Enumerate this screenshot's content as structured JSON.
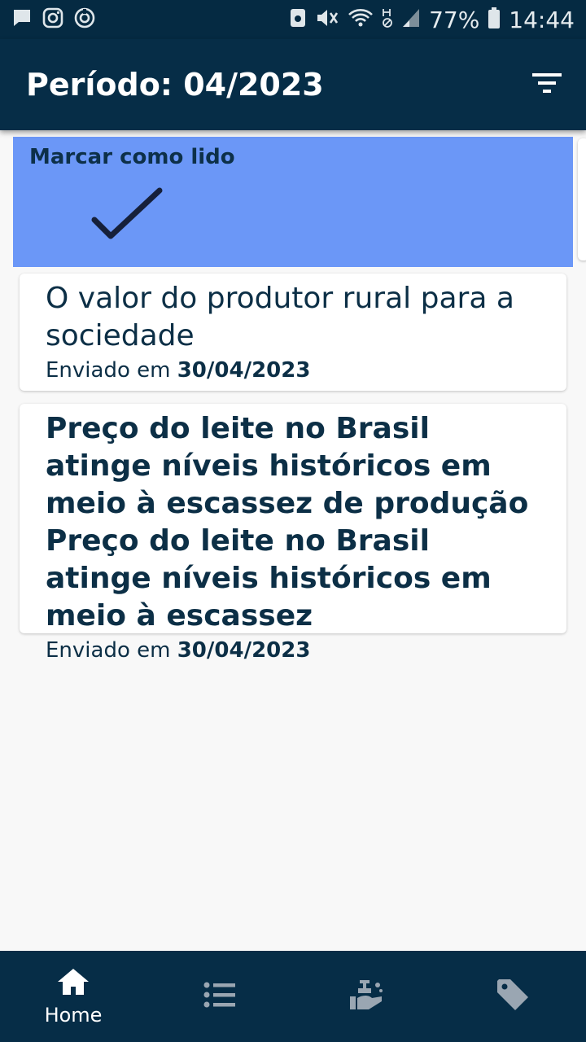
{
  "status_bar": {
    "battery": "77%",
    "time": "14:44",
    "left_icons": [
      "chat-icon",
      "instagram-icon",
      "sync-icon"
    ],
    "right_icons": [
      "save-icon",
      "mute-icon",
      "wifi-icon",
      "hd-icon",
      "signal-icon",
      "battery-icon"
    ]
  },
  "app_bar": {
    "title": "Período: 04/2023",
    "filter_icon": "filter-list-icon"
  },
  "swipe_action": {
    "label": "Marcar como lido",
    "icon": "check-icon",
    "color": "#6b97f7"
  },
  "messages": [
    {
      "title": "O valor do produtor rural para a sociedade",
      "sent_prefix": "Enviado em",
      "sent_date": "30/04/2023",
      "read": true
    },
    {
      "title": "Preço do leite no Brasil atinge níveis históricos em meio à escassez de produção Preço do leite no Brasil atinge níveis históricos em meio à escassez",
      "sent_prefix": "Enviado em",
      "sent_date": "30/04/2023",
      "read": false
    }
  ],
  "bottom_nav": {
    "items": [
      {
        "icon": "home-icon",
        "label": "Home",
        "active": true
      },
      {
        "icon": "list-icon",
        "label": "",
        "active": false
      },
      {
        "icon": "hand-wash-icon",
        "label": "",
        "active": false
      },
      {
        "icon": "tag-icon",
        "label": "",
        "active": false
      }
    ]
  },
  "colors": {
    "primary": "#062d47",
    "text": "#0c2f46",
    "swipe": "#6b97f7",
    "background": "#f8f8f8"
  }
}
